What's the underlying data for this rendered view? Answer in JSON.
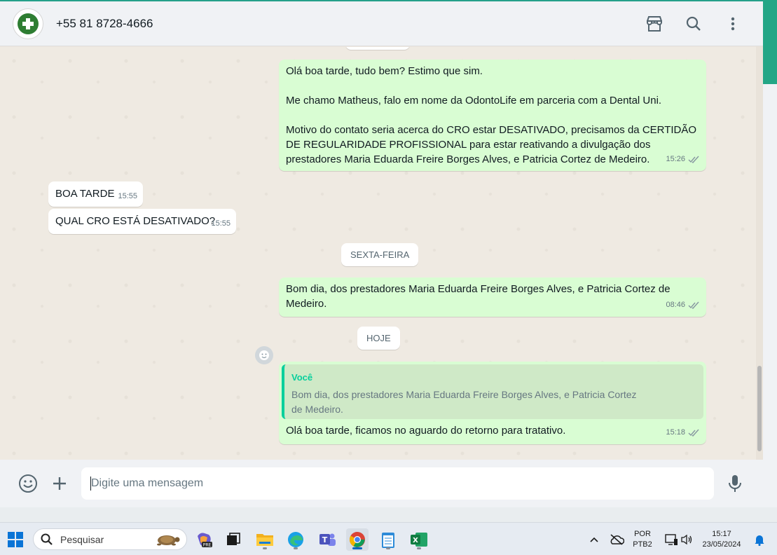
{
  "header": {
    "contact_name": "+55 81 8728-4666",
    "icons": [
      "catalog-icon",
      "search-icon",
      "more-vert-icon"
    ]
  },
  "messages": [
    {
      "direction": "out",
      "lines": [
        "Olá boa tarde, tudo bem? Estimo que sim.",
        "",
        "Me chamo Matheus, falo em nome da OdontoLife em parceria com a Dental Uni.",
        "",
        "Motivo do contato seria acerca do CRO estar DESATIVADO, precisamos da CERTIDÃO",
        "DE REGULARIDADE PROFISSIONAL para estar reativando a divulgação dos",
        "prestadores Maria Eduarda Freire Borges Alves, e Patricia Cortez de Medeiro."
      ],
      "time": "15:26"
    },
    {
      "direction": "in",
      "text": "BOA TARDE",
      "time": "15:55"
    },
    {
      "direction": "in",
      "text": "QUAL CRO ESTÁ DESATIVADO?",
      "time": "15:55"
    },
    {
      "direction": "out",
      "lines": [
        "Bom dia, dos prestadores Maria Eduarda Freire Borges Alves, e Patricia Cortez de",
        "Medeiro."
      ],
      "time": "08:46"
    },
    {
      "direction": "out",
      "quote_author": "Você",
      "quote_lines": [
        "Bom dia, dos prestadores Maria Eduarda Freire Borges Alves, e Patricia Cortez",
        "de Medeiro."
      ],
      "text": "Olá boa tarde, ficamos no aguardo do retorno para tratativo.",
      "time": "15:18"
    }
  ],
  "date_chips": {
    "friday": "SEXTA-FEIRA",
    "today": "HOJE"
  },
  "composer": {
    "placeholder": "Digite uma mensagem"
  },
  "taskbar": {
    "search_label": "Pesquisar",
    "apps": [
      "windows-start",
      "copilot-pre",
      "task-view",
      "file-explorer",
      "edge",
      "teams",
      "chrome",
      "notepad",
      "excel"
    ],
    "language_line1": "POR",
    "language_line2": "PTB2",
    "time": "15:17",
    "date": "23/05/2024"
  },
  "colors": {
    "outgoing_bubble": "#d9fdd3",
    "incoming_bubble": "#ffffff",
    "accent": "#06cf9c",
    "tick_read": "#8696a0"
  }
}
